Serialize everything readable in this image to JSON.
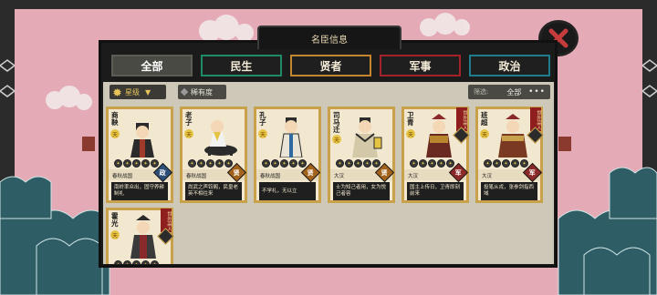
{
  "window": {
    "title": "名臣信息"
  },
  "tabs": [
    {
      "label": "全部",
      "active": true
    },
    {
      "label": "民生"
    },
    {
      "label": "贤者"
    },
    {
      "label": "军事"
    },
    {
      "label": "政治"
    }
  ],
  "filters": {
    "sort_label": "星级",
    "rarity_label": "稀有度",
    "filter_label": "筛选:",
    "filter_value": "全部"
  },
  "cards": [
    {
      "name": "商鞅",
      "grade": "天",
      "stars": 5,
      "era": "春秋战国",
      "type": "政",
      "desc": "南岭率众出，固守养耕制礼",
      "ribbon": ""
    },
    {
      "name": "老子",
      "grade": "天",
      "stars": 5,
      "era": "春秋战国",
      "type": "贤",
      "desc": "尚武之声钧阁，民皇老英不相往来",
      "ribbon": ""
    },
    {
      "name": "孔子",
      "grade": "天",
      "stars": 5,
      "era": "春秋战国",
      "type": "贤",
      "desc": "不学礼，无以立",
      "ribbon": ""
    },
    {
      "name": "司马迁",
      "grade": "天",
      "stars": 5,
      "era": "大汉",
      "type": "贤",
      "desc": "士为知己者用，女为悦己者容",
      "ribbon": ""
    },
    {
      "name": "卫青",
      "grade": "天",
      "stars": 5,
      "era": "大汉",
      "type": "军",
      "desc": "国主上传日，卫青即刻前来",
      "ribbon": "世外高人"
    },
    {
      "name": "班超",
      "grade": "天",
      "stars": 5,
      "era": "大汉",
      "type": "军",
      "desc": "投笔从戎，张参剑指西域",
      "ribbon": "世外高人"
    },
    {
      "name": "霍光",
      "grade": "天",
      "stars": 5,
      "era": "",
      "type": "",
      "desc": "",
      "ribbon": "世外高人"
    }
  ],
  "icons": {
    "close": "close-x-icon",
    "sort": "gear-icon",
    "rarity": "diamond-icon",
    "more": "ellipsis-icon"
  },
  "colors": {
    "tab_minsheng": "#1f8a6a",
    "tab_xianzhe": "#c4862e",
    "tab_junshi": "#a4222a",
    "tab_zhengzhi": "#1e7c8c",
    "card_border": "#c9a14a",
    "background": "#e4aab6"
  }
}
